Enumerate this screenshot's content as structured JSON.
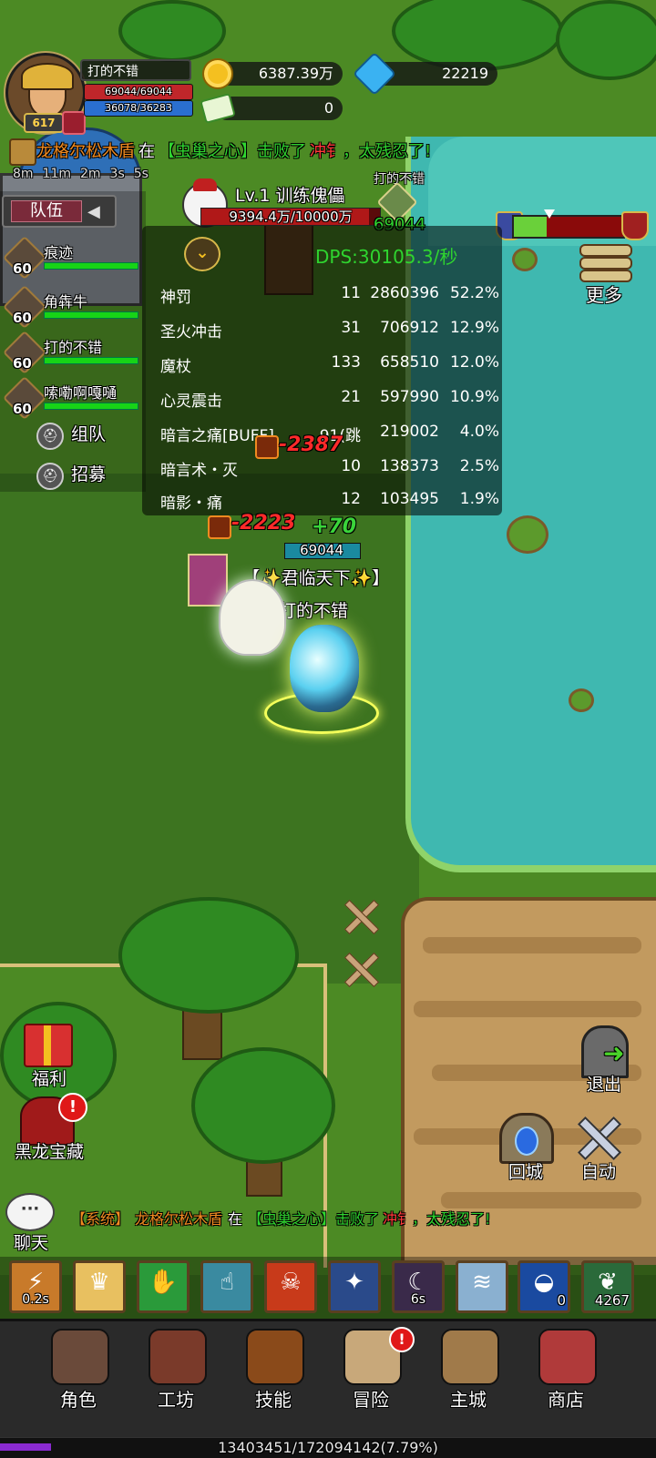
{
  "player": {
    "name": "打的不错",
    "level": "617",
    "hp": "69044/69044",
    "mp": "36078/36283"
  },
  "currency": {
    "gold": "6387.39万",
    "diamonds": "22219",
    "tickets": "0"
  },
  "announcement": {
    "killer": "龙格尔松木盾",
    "connector": "在",
    "location": "【虫巢之心】",
    "action": "击败了",
    "victim": "冲钅",
    "comment": "，太残忍了!"
  },
  "timers": [
    "8m",
    "11m",
    "2m",
    "3s",
    "5s"
  ],
  "team": {
    "title": "队伍",
    "toggle_icon": "◀",
    "members": [
      {
        "level": "60",
        "name": "痕迹",
        "hp_fraction": 1.0
      },
      {
        "level": "60",
        "name": "角犇牛",
        "hp_fraction": 1.0
      },
      {
        "level": "60",
        "name": "打的不错",
        "hp_fraction": 1.0
      },
      {
        "level": "60",
        "name": "嗦嘞啊嘎嗵",
        "hp_fraction": 1.0
      }
    ],
    "party_button": "组队",
    "recruit_button": "招募"
  },
  "target": {
    "name": "Lv.1 训练傀儡",
    "hp": "9394.4万/10000万",
    "hp_fraction": 0.939
  },
  "ally_nameplate": {
    "name": "打的不错",
    "hp": "69044"
  },
  "dps_meter": {
    "collapse_icon": "chevron-down-icon",
    "total": "DPS:30105.3/秒",
    "rows": [
      {
        "name": "神罚",
        "hits": "11",
        "damage": "2860396",
        "percent": "52.2%"
      },
      {
        "name": "圣火冲击",
        "hits": "31",
        "damage": "706912",
        "percent": "12.9%"
      },
      {
        "name": "魔杖",
        "hits": "133",
        "damage": "658510",
        "percent": "12.0%"
      },
      {
        "name": "心灵震击",
        "hits": "21",
        "damage": "597990",
        "percent": "10.9%"
      },
      {
        "name": "暗言之痛[BUFF]",
        "hits": "91(跳",
        "damage": "219002",
        "percent": "4.0%"
      },
      {
        "name": "暗言术・灭",
        "hits": "10",
        "damage": "138373",
        "percent": "2.5%"
      },
      {
        "name": "暗影・痛",
        "hits": "12",
        "damage": "103495",
        "percent": "1.9%"
      }
    ]
  },
  "faction_bar": {
    "blue_fraction": 0.3
  },
  "more_button": "更多",
  "battle": {
    "damage_1": "-2387",
    "damage_2": "-2223",
    "heal": "+70",
    "player_hp": "69044",
    "player_title": "【✨君临天下✨】",
    "player_name": "打的不错"
  },
  "left_actions": {
    "welfare": "福利",
    "dragon_treasure": "黑龙宝藏",
    "alert": "!"
  },
  "right_actions": {
    "exit": "退出",
    "return_city": "回城",
    "auto": "自动"
  },
  "chat": {
    "button": "聊天",
    "channel": "【系统】",
    "killer": "龙格尔松木盾",
    "connector": "在",
    "location": "【虫巢之心】",
    "action": "击败了",
    "victim": "冲钅",
    "comment": "，太残忍了!"
  },
  "skills": [
    {
      "name": "skill-1",
      "cooldown": "0.2s",
      "color": "#c87a2a"
    },
    {
      "name": "skill-2",
      "cooldown": "",
      "color": "#e8c060"
    },
    {
      "name": "skill-3",
      "cooldown": "",
      "color": "#2a9a3a"
    },
    {
      "name": "skill-4",
      "cooldown": "",
      "color": "#3a8aa0"
    },
    {
      "name": "skill-5",
      "cooldown": "",
      "color": "#c83a1a"
    },
    {
      "name": "skill-6",
      "cooldown": "",
      "color": "#2a4a8a"
    },
    {
      "name": "skill-7",
      "cooldown": "6s",
      "color": "#3a2a4a"
    },
    {
      "name": "skill-8",
      "cooldown": "",
      "color": "#8ab0d0"
    },
    {
      "name": "item-1",
      "count": "0",
      "color": "#1a4aa0"
    },
    {
      "name": "item-2",
      "count": "4267",
      "color": "#2a6a3a"
    }
  ],
  "nav": [
    {
      "label": "角色",
      "color": "#6a4a3a",
      "alert": ""
    },
    {
      "label": "工坊",
      "color": "#7a3a2a",
      "alert": ""
    },
    {
      "label": "技能",
      "color": "#8a4a1a",
      "alert": ""
    },
    {
      "label": "冒险",
      "color": "#c8a87a",
      "alert": "!"
    },
    {
      "label": "主城",
      "color": "#a07a4a",
      "alert": ""
    },
    {
      "label": "商店",
      "color": "#b03a3a",
      "alert": ""
    }
  ],
  "experience": {
    "text": "13403451/172094142(7.79%)",
    "fraction": 0.0779
  },
  "colors": {
    "hp_red": "#c0262a",
    "mp_blue": "#2a6fd0",
    "team_hp_green": "#17d417",
    "dps_green": "#2fd42f",
    "damage_red": "#ff2a2a",
    "announcement_orange": "#f08a20",
    "announcement_green": "#2fd42f",
    "announcement_red": "#ff3a3a",
    "xp_purple": "#8a2ad0"
  }
}
